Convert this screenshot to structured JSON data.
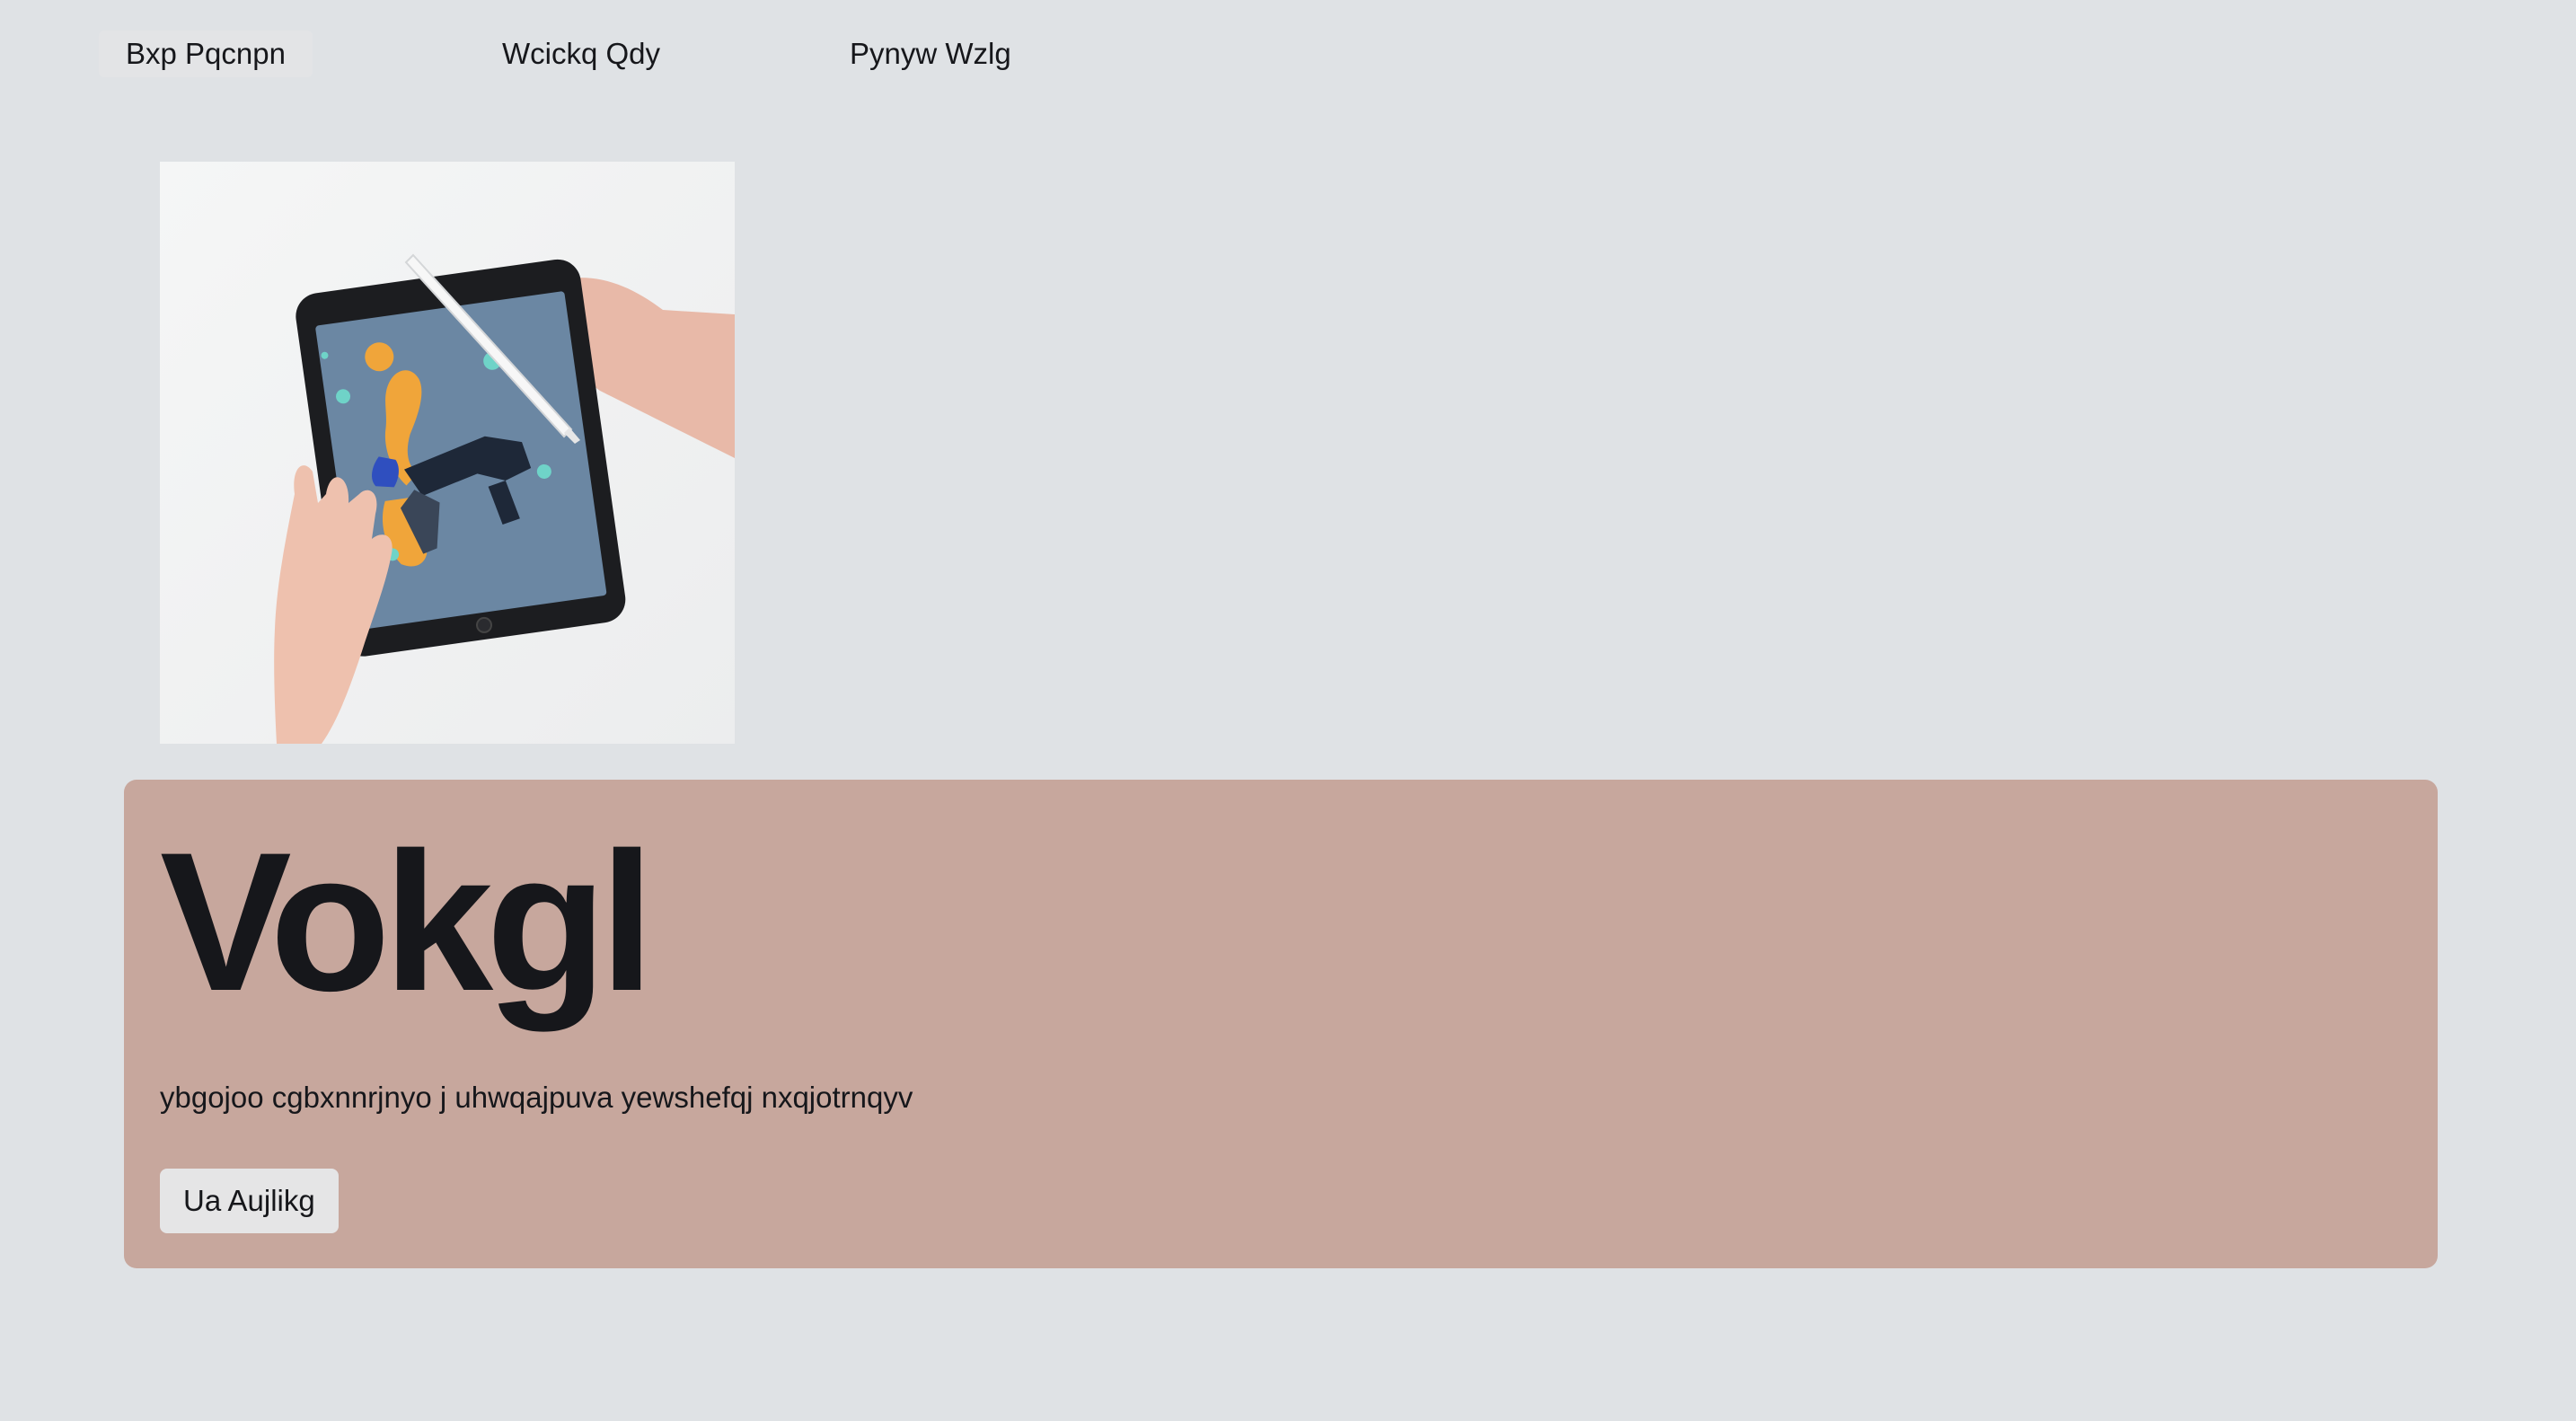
{
  "nav": {
    "items": [
      {
        "label": "Bxp Pqcnpn",
        "active": true
      },
      {
        "label": "Wcickq Qdy",
        "active": false
      },
      {
        "label": "Pynyw Wzlg",
        "active": false
      }
    ]
  },
  "hero": {
    "image_icon": "photo-hands-drawing-on-tablet"
  },
  "card": {
    "title": "Vokgl",
    "text": "ybgojoo cgbxnnrjnyo j uhwqajpuva yewshefqj nxqjotrnqyv",
    "button_label": "Ua Aujlikg",
    "background": "#c7a79d"
  },
  "colors": {
    "page_background": "#dfe2e5",
    "text": "#16171b",
    "button_background": "#e5e5e6"
  }
}
